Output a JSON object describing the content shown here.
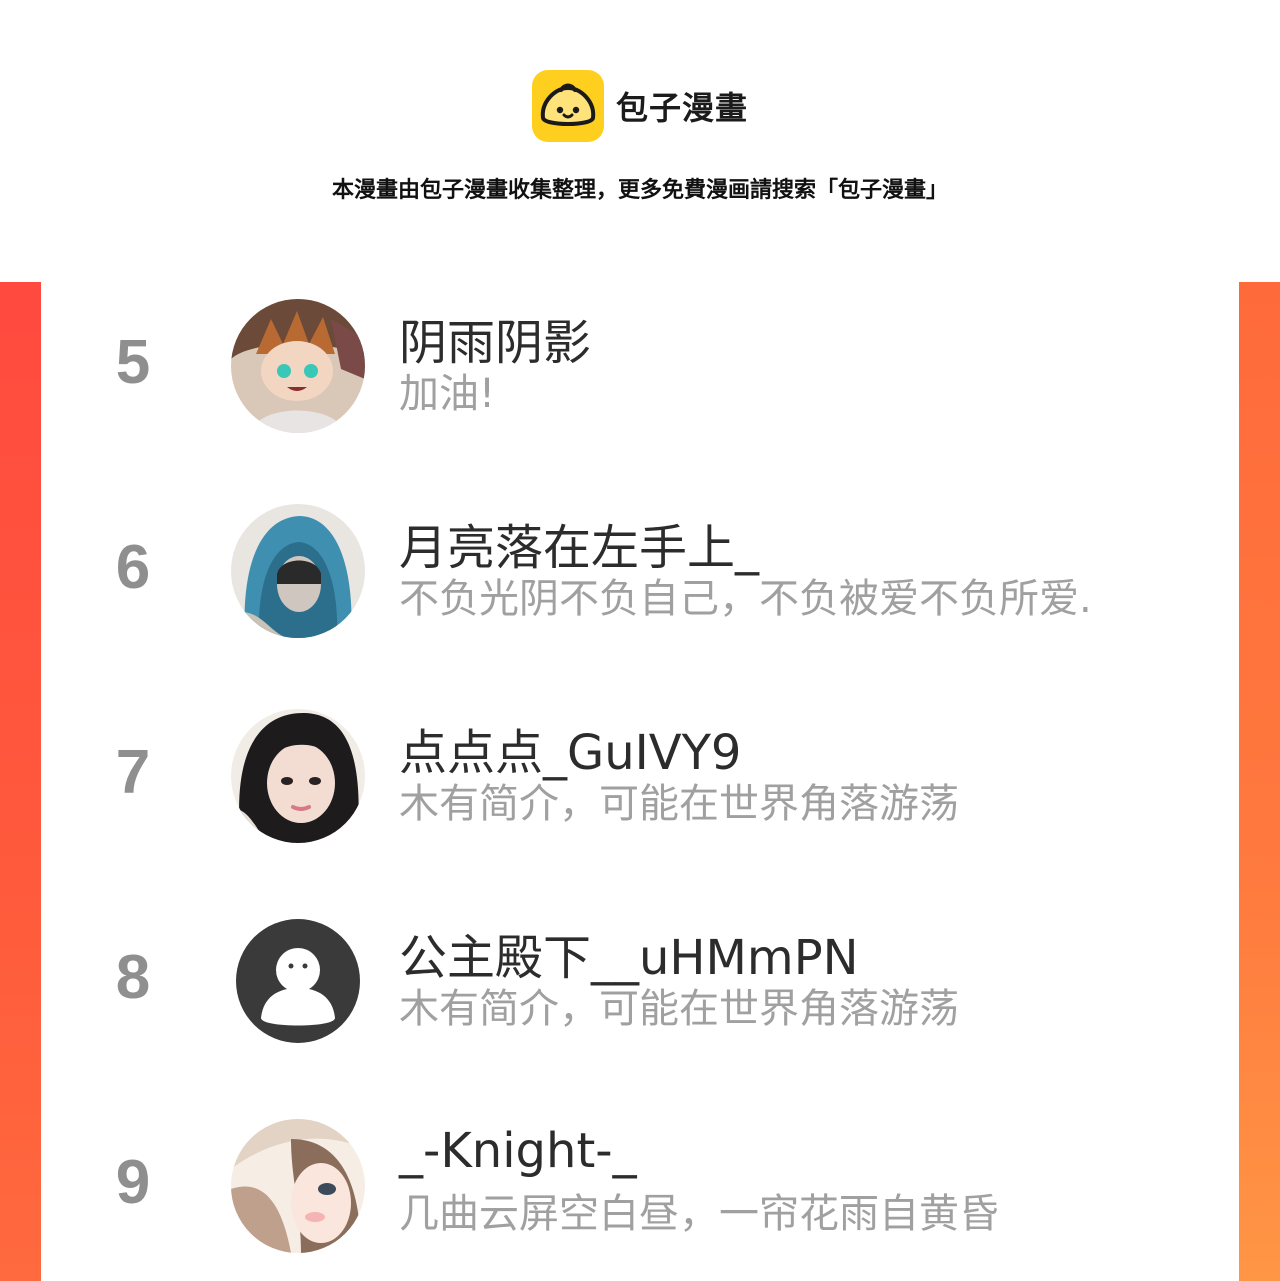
{
  "header": {
    "brand_name": "包子漫畫",
    "logo_icon": "baozi-icon",
    "notice": "本漫畫由包子漫畫收集整理，更多免費漫画請搜索「包子漫畫」"
  },
  "colors": {
    "accent_left": "#ff4a3f",
    "accent_right": "#ff7a3e",
    "logo_yellow": "#ffcf1f",
    "rank_gray": "#8f8f8f",
    "bio_gray": "#a0a0a0"
  },
  "ranking": [
    {
      "rank": "5",
      "name": "阴雨阴影",
      "bio": "加油!",
      "avatar": "anime-boy-avatar"
    },
    {
      "rank": "6",
      "name": "月亮落在左手上_",
      "bio": "不负光阴不负自己，不负被爱不负所爱.",
      "avatar": "hooded-person-avatar"
    },
    {
      "rank": "7",
      "name": "点点点_GuIVY9",
      "bio": "木有简介，可能在世界角落游荡",
      "avatar": "girl-photo-avatar"
    },
    {
      "rank": "8",
      "name": "公主殿下__uHMmPN",
      "bio": "木有简介，可能在世界角落游荡",
      "avatar": "default-user-avatar"
    },
    {
      "rank": "9",
      "name": "_-Knight-_",
      "bio": "几曲云屏空白昼，一帘花雨自黄昏",
      "avatar": "anime-girl-avatar"
    }
  ]
}
